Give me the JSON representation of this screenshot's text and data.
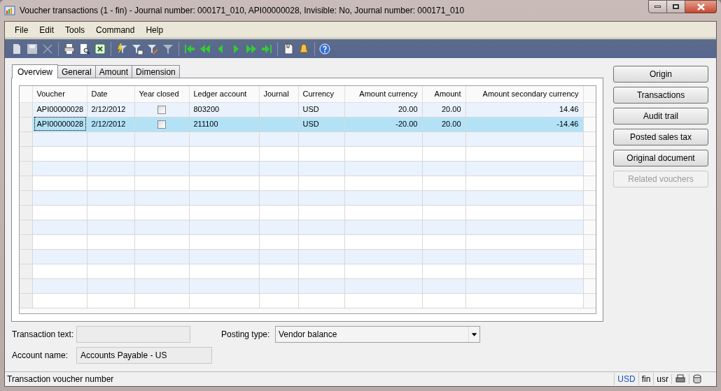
{
  "window": {
    "title": "Voucher transactions (1 - fin) - Journal number: 000171_010, API00000028, Invisible: No, Journal number: 000171_010"
  },
  "menu": [
    "File",
    "Edit",
    "Tools",
    "Command",
    "Help"
  ],
  "tabs": [
    {
      "label": "Overview",
      "selected": true
    },
    {
      "label": "General",
      "selected": false
    },
    {
      "label": "Amount",
      "selected": false
    },
    {
      "label": "Dimension",
      "selected": false
    }
  ],
  "table": {
    "columns": [
      "Voucher",
      "Date",
      "Year closed",
      "Ledger account",
      "Journal",
      "Currency",
      "Amount currency",
      "Amount",
      "Amount secondary currency"
    ],
    "rows": [
      {
        "selected": false,
        "voucher": "API00000028",
        "date": "2/12/2012",
        "year_closed": false,
        "ledger_account": "803200",
        "currency": "USD",
        "amount_currency": "20.00",
        "amount": "20.00",
        "amount_secondary_currency": "14.46"
      },
      {
        "selected": true,
        "voucher": "API00000028",
        "date": "2/12/2012",
        "year_closed": false,
        "ledger_account": "211100",
        "currency": "USD",
        "amount_currency": "-20.00",
        "amount": "20.00",
        "amount_secondary_currency": "-14.46"
      }
    ]
  },
  "buttons": [
    {
      "label": "Origin",
      "disabled": false
    },
    {
      "label": "Transactions",
      "disabled": false
    },
    {
      "label": "Audit trail",
      "disabled": false
    },
    {
      "label": "Posted sales tax",
      "disabled": false
    },
    {
      "label": "Original document",
      "disabled": false
    },
    {
      "label": "Related vouchers",
      "disabled": true
    }
  ],
  "fields": {
    "transaction_text": {
      "label": "Transaction text:"
    },
    "posting_type": {
      "label": "Posting type:",
      "value": "Vendor balance"
    },
    "account_name": {
      "label": "Account name:",
      "value": "Accounts Payable - US"
    }
  },
  "status_bar": {
    "text": "Transaction voucher number",
    "currency": "USD",
    "company": "fin",
    "user": "usr"
  }
}
